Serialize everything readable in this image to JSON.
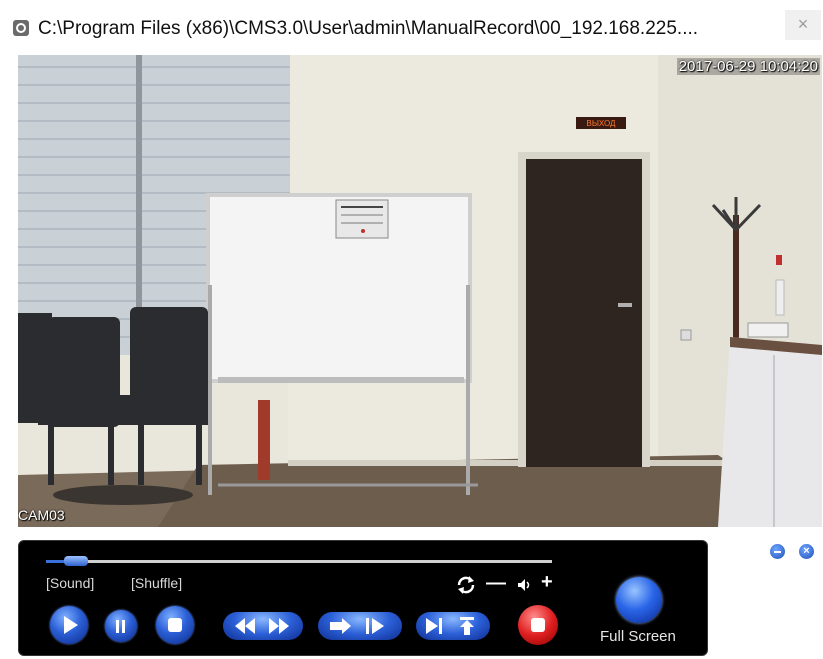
{
  "window": {
    "title": "C:\\Program Files (x86)\\CMS3.0\\User\\admin\\ManualRecord\\00_192.168.225....",
    "close_glyph": "×",
    "icon": "app-record-icon"
  },
  "video": {
    "timestamp": "2017-06-29 10:04:20",
    "camera_name": "CAM03",
    "exit_sign": "ВЫХОД"
  },
  "player": {
    "progress": 0.06,
    "sound_label": "[Sound]",
    "shuffle_label": "[Shuffle]",
    "volume_minus": "—",
    "volume_plus": "+",
    "full_screen_label": "Full Screen",
    "accent_color": "#2b5fd6",
    "record_color": "#e02020",
    "icons": [
      "play-icon",
      "pause-icon",
      "stop-icon",
      "rewind-icon",
      "fast-forward-icon",
      "step-back-icon",
      "step-forward-icon",
      "frame-next-icon",
      "upload-icon",
      "record-icon",
      "refresh-icon",
      "speaker-icon"
    ]
  },
  "panel_controls": {
    "minimize_glyph": "−",
    "close_glyph": "×"
  }
}
